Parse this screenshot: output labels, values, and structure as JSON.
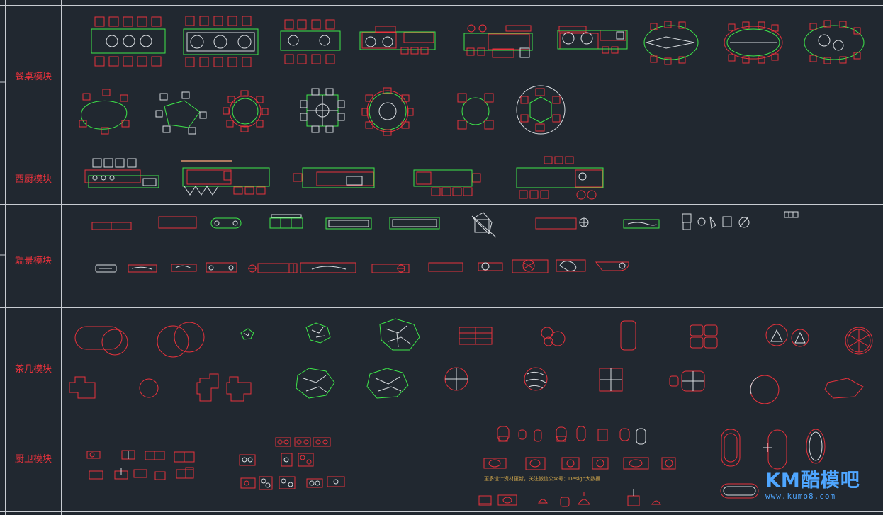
{
  "sections": [
    {
      "id": "dining",
      "label": "餐桌模块"
    },
    {
      "id": "western_kitchen",
      "label": "西厨模块"
    },
    {
      "id": "end_view",
      "label": "端景模块"
    },
    {
      "id": "tea_table",
      "label": "茶几模块"
    },
    {
      "id": "kitchen_bath",
      "label": "厨卫模块"
    }
  ],
  "kitchen_note": "更多设计资材更新，关注微信公众号：Design大数据",
  "watermark": {
    "brand": "KM酷模吧",
    "url": "www.kumo8.com"
  },
  "colors": {
    "background": "#212830",
    "grid_line": "#c8ccd2",
    "red": "#e8323c",
    "green": "#3ee84a",
    "white": "#d8dce0",
    "accent_blue": "#4fa6ff"
  }
}
